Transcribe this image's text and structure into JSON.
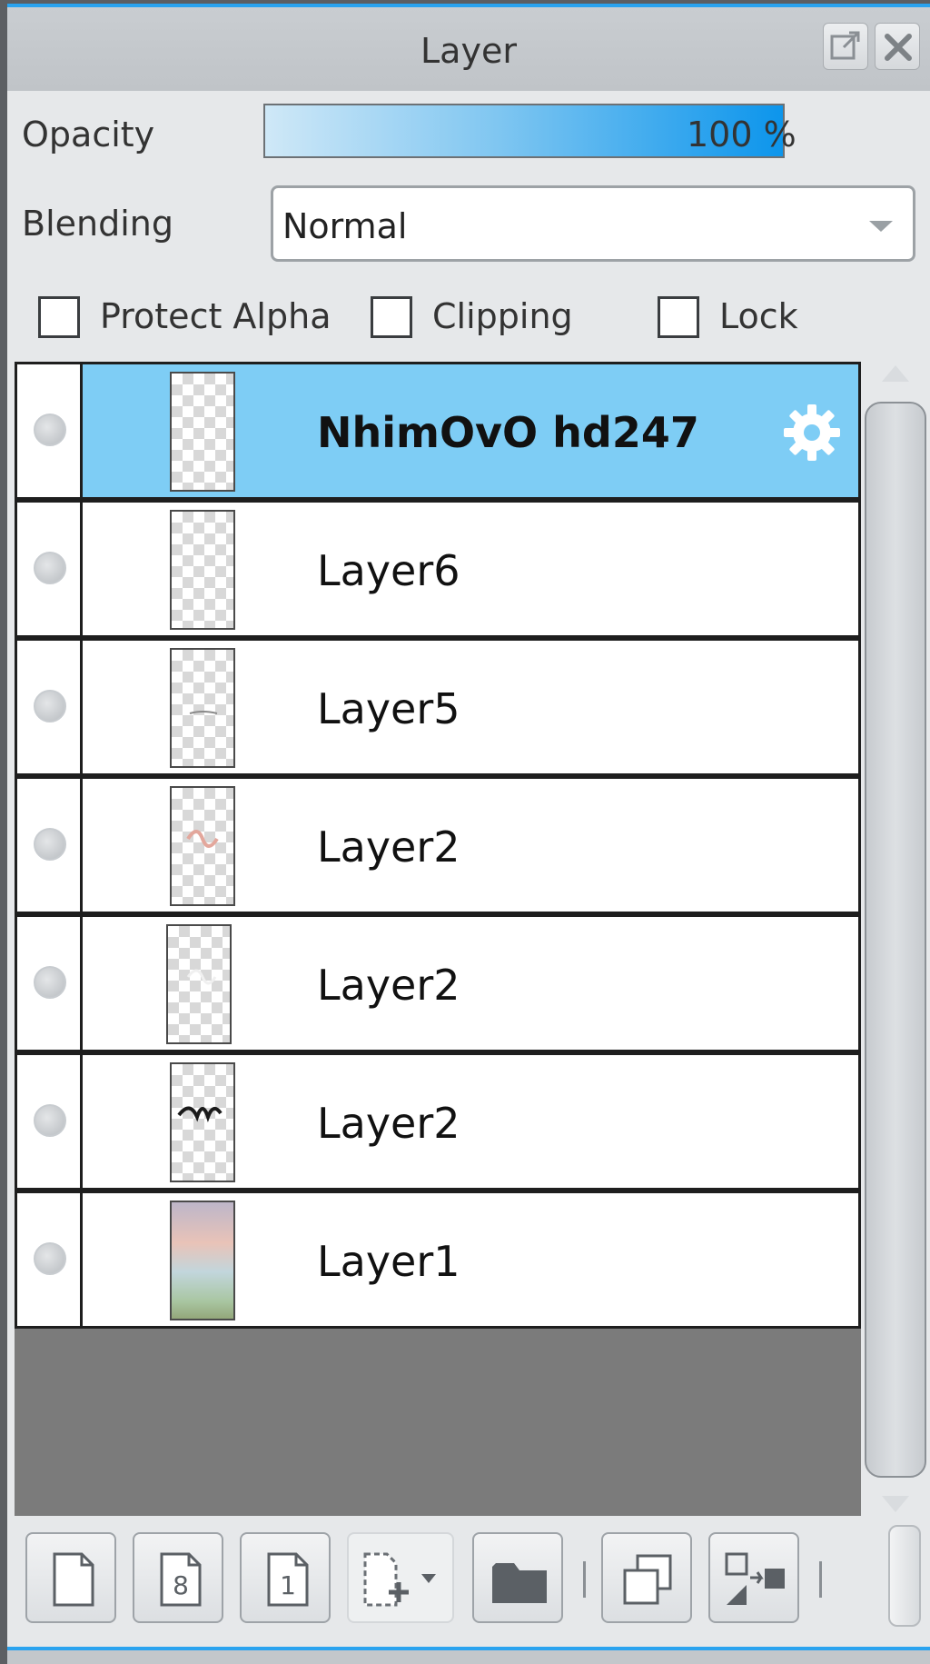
{
  "panel": {
    "title": "Layer",
    "float_icon": "float-window-icon",
    "close_icon": "close-icon"
  },
  "opacity": {
    "label": "Opacity",
    "value_text": "100 %",
    "value": 100
  },
  "blending": {
    "label": "Blending",
    "value": "Normal"
  },
  "options": {
    "protect_alpha": {
      "label": "Protect Alpha",
      "checked": false
    },
    "clipping": {
      "label": "Clipping",
      "checked": false
    },
    "lock": {
      "label": "Lock",
      "checked": false
    }
  },
  "layers": [
    {
      "name": "NhimOvO hd247",
      "selected": true
    },
    {
      "name": "Layer6",
      "selected": false
    },
    {
      "name": "Layer5",
      "selected": false
    },
    {
      "name": "Layer2",
      "selected": false
    },
    {
      "name": "Layer2",
      "selected": false
    },
    {
      "name": "Layer2",
      "selected": false
    },
    {
      "name": "Layer1",
      "selected": false
    }
  ],
  "toolbar": {
    "buttons": [
      {
        "icon": "new-layer-icon"
      },
      {
        "icon": "new-8bit-layer-icon",
        "glyph": "8"
      },
      {
        "icon": "new-1bit-layer-icon",
        "glyph": "1"
      },
      {
        "icon": "add-layer-menu-icon"
      },
      {
        "icon": "new-folder-icon"
      },
      {
        "icon": "duplicate-layer-icon"
      },
      {
        "icon": "merge-down-icon"
      }
    ]
  },
  "colors": {
    "accent": "#2aa3ef",
    "selected_row": "#7ecdf5",
    "list_bg": "#7b7b7b",
    "panel_bg": "#e6e8ea"
  }
}
